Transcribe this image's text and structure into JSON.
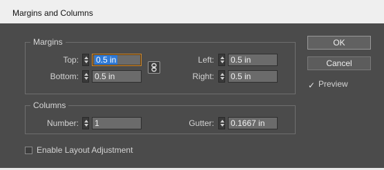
{
  "window": {
    "title": "Margins and Columns"
  },
  "margins": {
    "legend": "Margins",
    "top": {
      "label": "Top:",
      "value": "0.5 in"
    },
    "bottom": {
      "label": "Bottom:",
      "value": "0.5 in"
    },
    "left": {
      "label": "Left:",
      "value": "0.5 in"
    },
    "right": {
      "label": "Right:",
      "value": "0.5 in"
    },
    "link_icon": "chain-link-icon"
  },
  "columns": {
    "legend": "Columns",
    "number": {
      "label": "Number:",
      "value": "1"
    },
    "gutter": {
      "label": "Gutter:",
      "value": "0.1667 in"
    }
  },
  "options": {
    "enable_layout_adjustment": {
      "label": "Enable Layout Adjustment",
      "checked": false
    },
    "preview": {
      "label": "Preview",
      "checked": true
    }
  },
  "buttons": {
    "ok": "OK",
    "cancel": "Cancel"
  },
  "colors": {
    "dialog_bg": "#4b4b4b",
    "field_bg": "#6b6b6b",
    "focus_border": "#d08a2e",
    "selection": "#2f79d6"
  }
}
